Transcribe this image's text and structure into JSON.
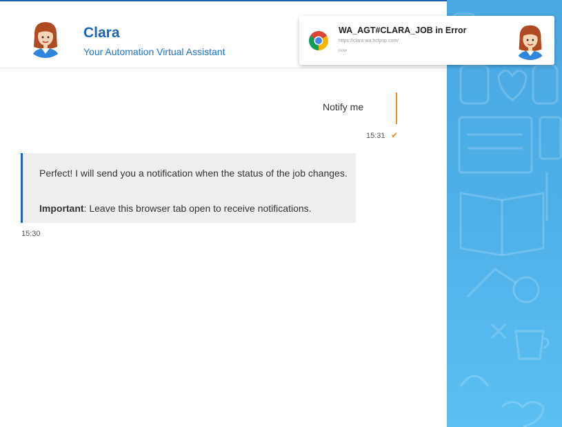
{
  "header": {
    "name": "Clara",
    "subtitle": "Your Automation Virtual Assistant"
  },
  "notification": {
    "title": "WA_AGT#CLARA_JOB in Error",
    "url": "https://clara-wa.hclpnp.com/",
    "time": "now",
    "app_icon": "chrome-icon"
  },
  "chat": {
    "user_message": {
      "text": "Notify me",
      "time": "15:31",
      "status_icon": "check-icon"
    },
    "bot_message": {
      "line1": "Perfect! I will send you a notification when the status of the job changes.",
      "important_label": "Important",
      "important_text": ": Leave this browser tab open to receive notifications.",
      "time": "15:30"
    }
  },
  "colors": {
    "accent": "#1a65b8",
    "user_bar": "#f08a24",
    "sidebar": "#4fb0e8"
  }
}
